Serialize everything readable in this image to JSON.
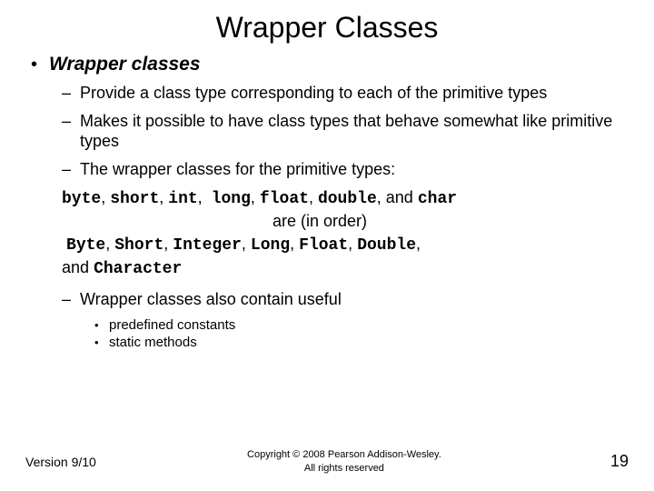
{
  "title": "Wrapper Classes",
  "heading": "Wrapper classes",
  "bullets": {
    "b1": "Provide a class type corresponding to each of the primitive types",
    "b2": "Makes it possible to have class types that behave somewhat like primitive types",
    "b3": "The wrapper classes for the primitive types:",
    "b4": "Wrapper classes also contain useful"
  },
  "types": {
    "prims": [
      "byte",
      "short",
      "int",
      "long",
      "float",
      "double",
      "char"
    ],
    "conj_and": "and",
    "middle": "are (in order)",
    "wrappers": [
      "Byte",
      "Short",
      "Integer",
      "Long",
      "Float",
      "Double",
      "Character"
    ]
  },
  "sub": {
    "s1": "predefined constants",
    "s2": "static methods"
  },
  "footer": {
    "version": "Version 9/10",
    "copyright_l1": "Copyright © 2008 Pearson Addison-Wesley.",
    "copyright_l2": "All rights reserved",
    "page": "19"
  }
}
